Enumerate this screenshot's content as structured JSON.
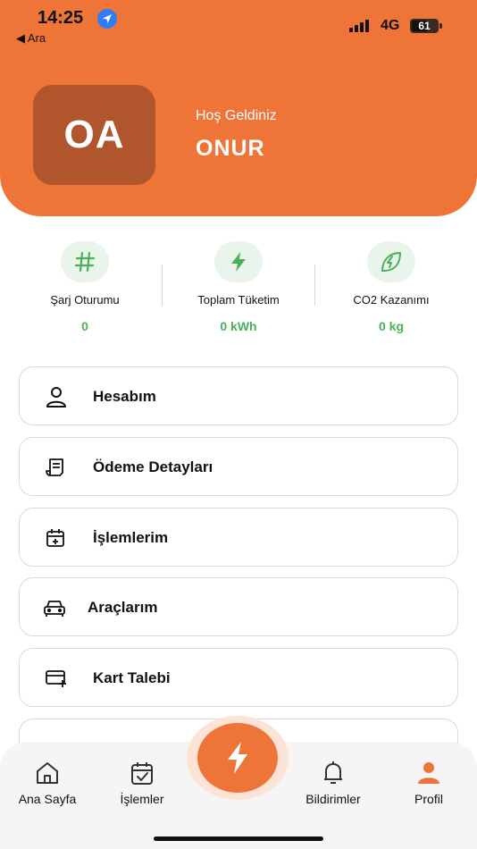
{
  "status_bar": {
    "time": "14:25",
    "back_label": "◀ Ara",
    "network": "4G",
    "battery": "61"
  },
  "profile": {
    "initials": "OA",
    "greeting": "Hoş Geldiniz",
    "name": "ONUR"
  },
  "stats": [
    {
      "icon": "hash-icon",
      "label": "Şarj Oturumu",
      "value": "0"
    },
    {
      "icon": "lightning-icon",
      "label": "Toplam Tüketim",
      "value": "0 kWh"
    },
    {
      "icon": "leaf-icon",
      "label": "CO2 Kazanımı",
      "value": "0 kg"
    }
  ],
  "menu": [
    {
      "icon": "user-icon",
      "label": "Hesabım"
    },
    {
      "icon": "receipt-icon",
      "label": "Ödeme Detayları"
    },
    {
      "icon": "calendar-add-icon",
      "label": "İşlemlerim"
    },
    {
      "icon": "car-icon",
      "label": "Araçlarım"
    },
    {
      "icon": "card-add-icon",
      "label": "Kart Talebi"
    }
  ],
  "tabs": [
    {
      "icon": "home-icon",
      "label": "Ana Sayfa"
    },
    {
      "icon": "calendar-check-icon",
      "label": "İşlemler"
    },
    {
      "icon": "bell-icon",
      "label": "Bildirimler"
    },
    {
      "icon": "profile-icon",
      "label": "Profil"
    }
  ],
  "colors": {
    "brand": "#ee7537",
    "avatar": "#b0552c",
    "stat_green": "#4cb05a"
  }
}
